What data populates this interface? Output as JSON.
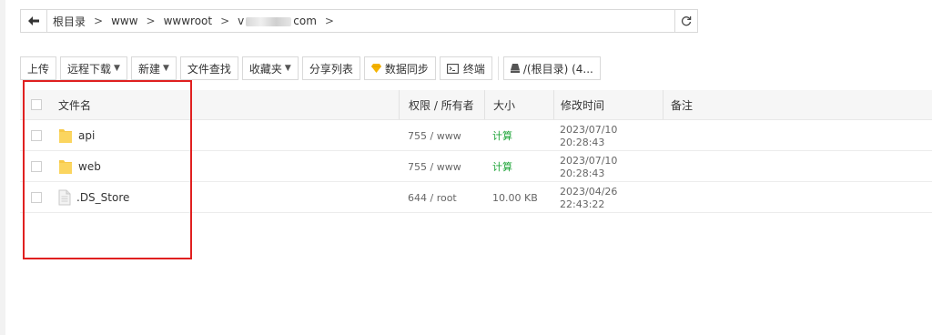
{
  "breadcrumb": {
    "items": [
      "根目录",
      "www",
      "wwwroot",
      "v",
      "com"
    ]
  },
  "toolbar": {
    "upload": "上传",
    "remote_download": "远程下载",
    "new": "新建",
    "file_search": "文件查找",
    "favorites": "收藏夹",
    "share_list": "分享列表",
    "data_sync": "数据同步",
    "terminal": "终端",
    "disk": "/(根目录) (4..."
  },
  "table": {
    "headers": {
      "name": "文件名",
      "perm": "权限 / 所有者",
      "size": "大小",
      "mtime": "修改时间",
      "note": "备注"
    },
    "rows": [
      {
        "name": "api",
        "type": "folder",
        "perm": "755 / www",
        "size": "计算",
        "mtime": "2023/07/10 20:28:43"
      },
      {
        "name": "web",
        "type": "folder",
        "perm": "755 / www",
        "size": "计算",
        "mtime": "2023/07/10 20:28:43"
      },
      {
        "name": ".DS_Store",
        "type": "file",
        "perm": "644 / root",
        "size": "10.00 KB",
        "mtime": "2023/04/26 22:43:22"
      }
    ]
  },
  "colors": {
    "accent_green": "#20a53a",
    "highlight_red": "#e02020",
    "folder_yellow": "#f7c948"
  }
}
